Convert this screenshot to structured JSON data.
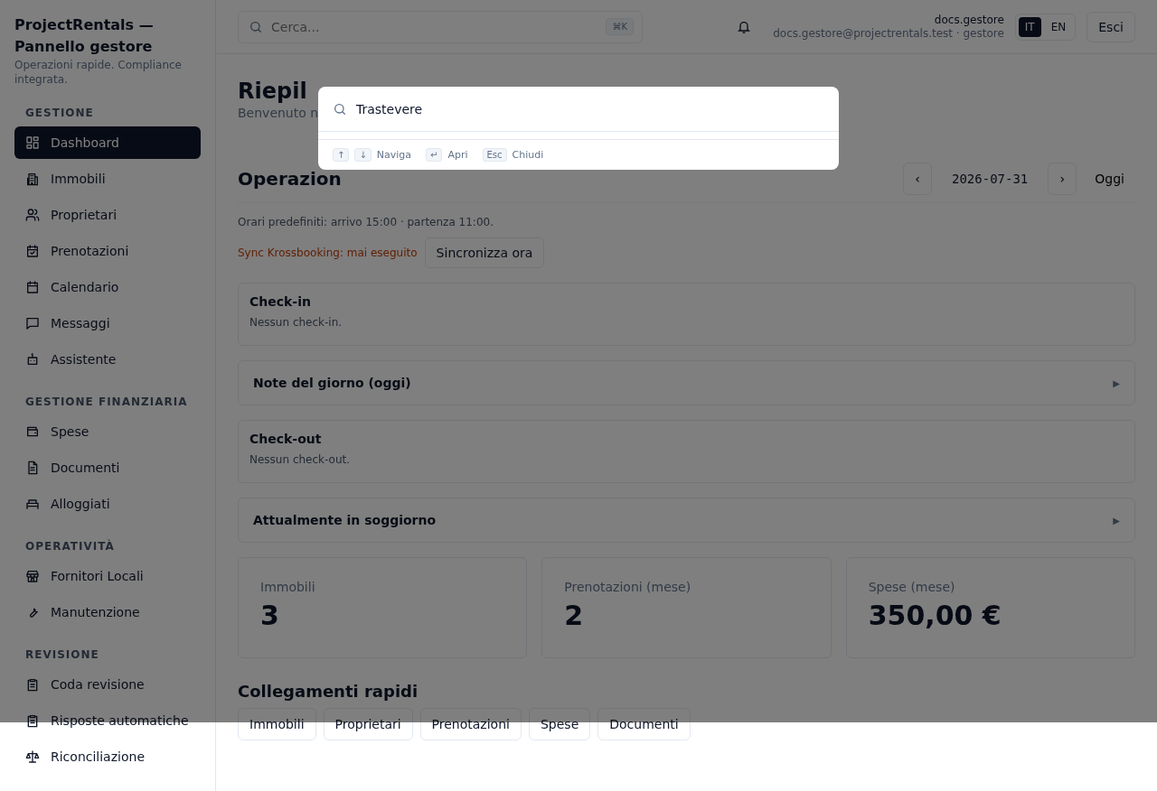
{
  "brand": {
    "title": "ProjectRentals — Pannello gestore",
    "tagline": "Operazioni rapide. Compliance integrata."
  },
  "sidebar": {
    "sections": [
      {
        "heading": "GESTIONE",
        "items": [
          {
            "label": "Dashboard",
            "selected": true
          },
          {
            "label": "Immobili",
            "selected": false
          },
          {
            "label": "Proprietari",
            "selected": false
          },
          {
            "label": "Prenotazioni",
            "selected": false
          },
          {
            "label": "Calendario",
            "selected": false
          },
          {
            "label": "Messaggi",
            "selected": false
          },
          {
            "label": "Assistente",
            "selected": false
          }
        ]
      },
      {
        "heading": "GESTIONE FINANZIARIA",
        "items": [
          {
            "label": "Spese",
            "selected": false
          },
          {
            "label": "Documenti",
            "selected": false
          },
          {
            "label": "Alloggiati",
            "selected": false
          }
        ]
      },
      {
        "heading": "OPERATIVITÀ",
        "items": [
          {
            "label": "Fornitori Locali",
            "selected": false
          },
          {
            "label": "Manutenzione",
            "selected": false
          }
        ]
      },
      {
        "heading": "REVISIONE",
        "items": [
          {
            "label": "Coda revisione",
            "selected": false
          },
          {
            "label": "Risposte automatiche",
            "selected": false
          },
          {
            "label": "Riconciliazione",
            "selected": false
          }
        ]
      }
    ]
  },
  "header": {
    "search": {
      "placeholder": "Cerca...",
      "shortcut": "⌘K"
    },
    "user": {
      "name": "docs.gestore",
      "detail": "docs.gestore@projectrentals.test · gestore"
    },
    "languages": [
      {
        "label": "IT",
        "selected": true
      },
      {
        "label": "EN",
        "selected": false
      }
    ],
    "logout": "Esci"
  },
  "page": {
    "title": "Riepil",
    "subtitle": "Benvenuto n"
  },
  "operations": {
    "title": "Operazion",
    "date": "2026-07-31",
    "prev": "‹",
    "next": "›",
    "today": "Oggi",
    "default_hours": "Orari predefiniti: arrivo 15:00 · partenza 11:00.",
    "sync_status": "Sync Krossbooking: mai eseguito",
    "sync_button": "Sincronizza ora",
    "sections": [
      {
        "kind": "card",
        "title": "Check-in",
        "text": "Nessun check-in."
      },
      {
        "kind": "collapsible",
        "title": "Note del giorno (oggi)",
        "expanded": false,
        "toggle": "▶"
      },
      {
        "kind": "card",
        "title": "Check-out",
        "text": "Nessun check-out."
      },
      {
        "kind": "collapsible",
        "title": "Attualmente in soggiorno",
        "expanded": false,
        "toggle": "▶"
      }
    ]
  },
  "stats": [
    {
      "label": "Immobili",
      "value": "3"
    },
    {
      "label": "Prenotazioni (mese)",
      "value": "2"
    },
    {
      "label": "Spese (mese)",
      "value": "350,00 €"
    }
  ],
  "quick_links": {
    "title": "Collegamenti rapidi",
    "links": [
      "Immobili",
      "Proprietari",
      "Prenotazioni",
      "Spese",
      "Documenti"
    ]
  },
  "command_palette": {
    "query": "Trastevere",
    "hints": [
      {
        "keys": [
          "↑",
          "↓"
        ],
        "label": "Naviga"
      },
      {
        "keys": [
          "↵"
        ],
        "label": "Apri"
      },
      {
        "keys": [
          "Esc"
        ],
        "label": "Chiudi"
      }
    ]
  }
}
